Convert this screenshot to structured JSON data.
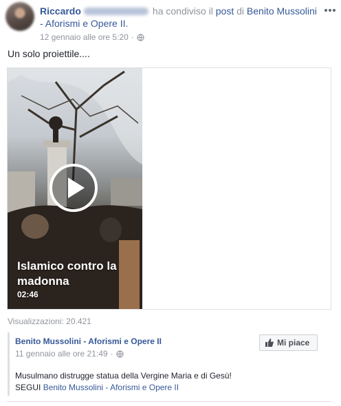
{
  "post": {
    "author": "Riccardo",
    "action": "ha condiviso il",
    "object": "post",
    "preposition": "di",
    "page_line1": "Benito Mussolini",
    "page_line2": "- Aforismi e Opere II.",
    "date": "12 gennaio alle ore 5:20",
    "dot": "·",
    "text": "Un solo proiettile....",
    "views": "Visualizzazioni: 20.421"
  },
  "video": {
    "title": "Islamico contro la madonna",
    "duration": "02:46"
  },
  "shared": {
    "page_name": "Benito Mussolini - Aforismi e Opere II",
    "date": "11 gennaio alle ore 21:49",
    "dot": "·",
    "like_label": "Mi piace",
    "text_line1": "Musulmano distrugge statua della Vergine Maria e di Gesù!",
    "text_line2_prefix": "SEGUI",
    "text_line2_link": "Benito Mussolini - Aforismi e Opere II"
  },
  "icons": {
    "more": "more-options-icon",
    "globe": "globe-icon",
    "play": "play-icon",
    "thumbs_up": "thumbs-up-icon"
  },
  "colors": {
    "link": "#365899",
    "meta": "#90949c",
    "text": "#1d2129",
    "border": "#dddfe2"
  }
}
